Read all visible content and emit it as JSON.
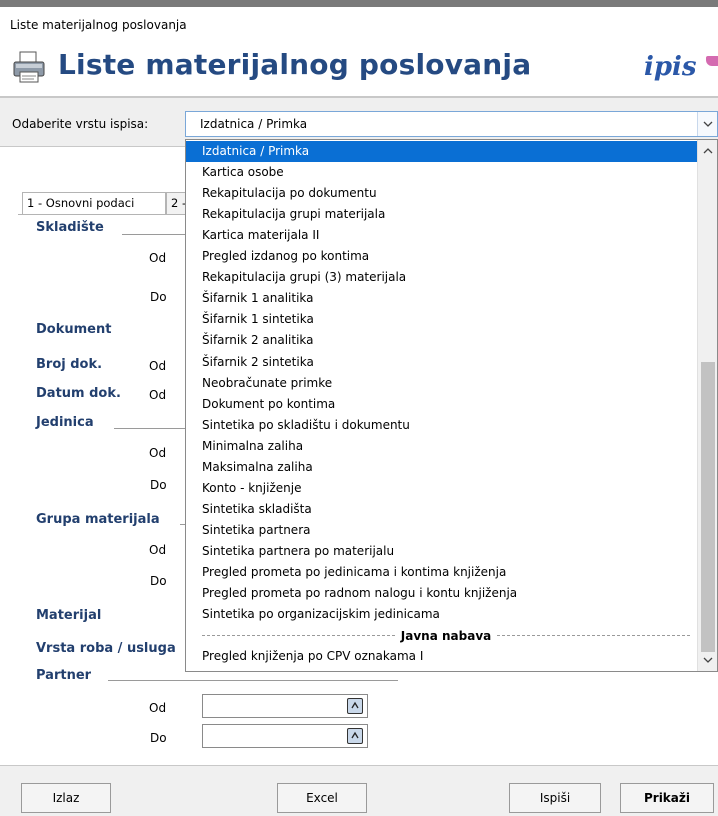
{
  "window": {
    "title": "Liste materijalnog poslovanja"
  },
  "header": {
    "title": "Liste materijalnog poslovanja",
    "logo": "ipis"
  },
  "report_select": {
    "label": "Odaberite vrstu ispisa:",
    "value": "Izdatnica / Primka",
    "options": [
      "Izdatnica / Primka",
      "Kartica osobe",
      "Rekapitulacija po dokumentu",
      "Rekapitulacija grupi  materijala",
      "Kartica materijala II",
      "Pregled izdanog po kontima",
      "Rekapitulacija grupi (3) materijala",
      "Šifarnik 1 analitika",
      "Šifarnik 1 sintetika",
      "Šifarnik 2 analitika",
      "Šifarnik 2 sintetika",
      "Neobračunate primke",
      "Dokument po kontima",
      "Sintetika po skladištu i dokumentu",
      "Minimalna zaliha",
      "Maksimalna zaliha",
      "Konto - knjiženje",
      "Sintetika skladišta",
      "Sintetika partnera",
      "Sintetika partnera po materijalu",
      "Pregled prometa po jedinicama i kontima knjiženja",
      "Pregled prometa po radnom nalogu i kontu knjiženja",
      "Sintetika po organizacijskim jedinicama"
    ],
    "separator_label": "Javna nabava",
    "after_separator": [
      "Pregled knjiženja po CPV oznakama I"
    ]
  },
  "tabs": [
    "1 - Osnovni podaci",
    "2 -"
  ],
  "filters": {
    "skladiste": "Skladište",
    "dokument": "Dokument",
    "broj_dok": "Broj dok.",
    "datum_dok": "Datum dok.",
    "jedinica": "Jedinica",
    "grupa_materijala": "Grupa materijala",
    "materijal": "Materijal",
    "vrsta_roba": "Vrsta roba / usluga",
    "partner": "Partner",
    "od": "Od",
    "do": "Do"
  },
  "buttons": {
    "izlaz": "Izlaz",
    "excel": "Excel",
    "ispisi": "Ispiši",
    "prikazi": "Prikaži"
  }
}
